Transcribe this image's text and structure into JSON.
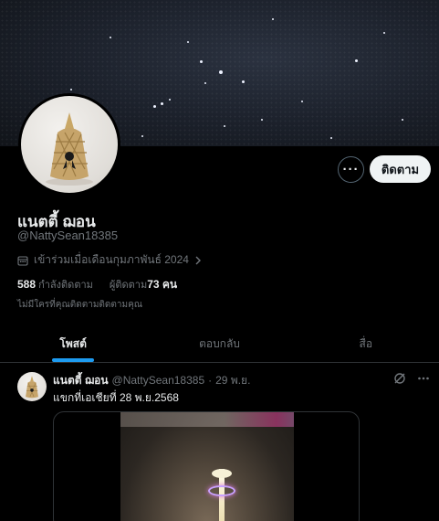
{
  "profile": {
    "display_name": "แนตตี้ ฌอน",
    "handle": "@NattySean18385",
    "joined": "เข้าร่วมเมื่อเดือนกุมภาพันธ์ 2024",
    "following_count": "588",
    "following_label": "กำลังติดตาม",
    "followers_label": "ผู้ติดตาม",
    "followers_count": "73 คน",
    "mutual_text": "ไม่มีใครที่คุณติดตามติดตามคุณ"
  },
  "actions": {
    "more_label": "···",
    "follow_label": "ติดตาม"
  },
  "tabs": [
    {
      "label": "โพสต์",
      "active": true
    },
    {
      "label": "ตอบกลับ",
      "active": false
    },
    {
      "label": "สื่อ",
      "active": false
    }
  ],
  "post": {
    "author_name": "แนตตี้ ฌอน",
    "author_handle": "@NattySean18385",
    "separator": "·",
    "date": "29 พ.ย.",
    "text": "แขกที่เอเชียที่ 28 พ.ย.2568"
  },
  "icons": {
    "calendar": "calendar-icon",
    "chevron": "chevron-right-icon",
    "grok": "grok-icon",
    "more": "more-horizontal-icon"
  },
  "colors": {
    "background": "#000000",
    "accent": "#1d9bf0",
    "text_primary": "#e7e9ea",
    "text_secondary": "#71767b",
    "border": "#2f3336"
  }
}
